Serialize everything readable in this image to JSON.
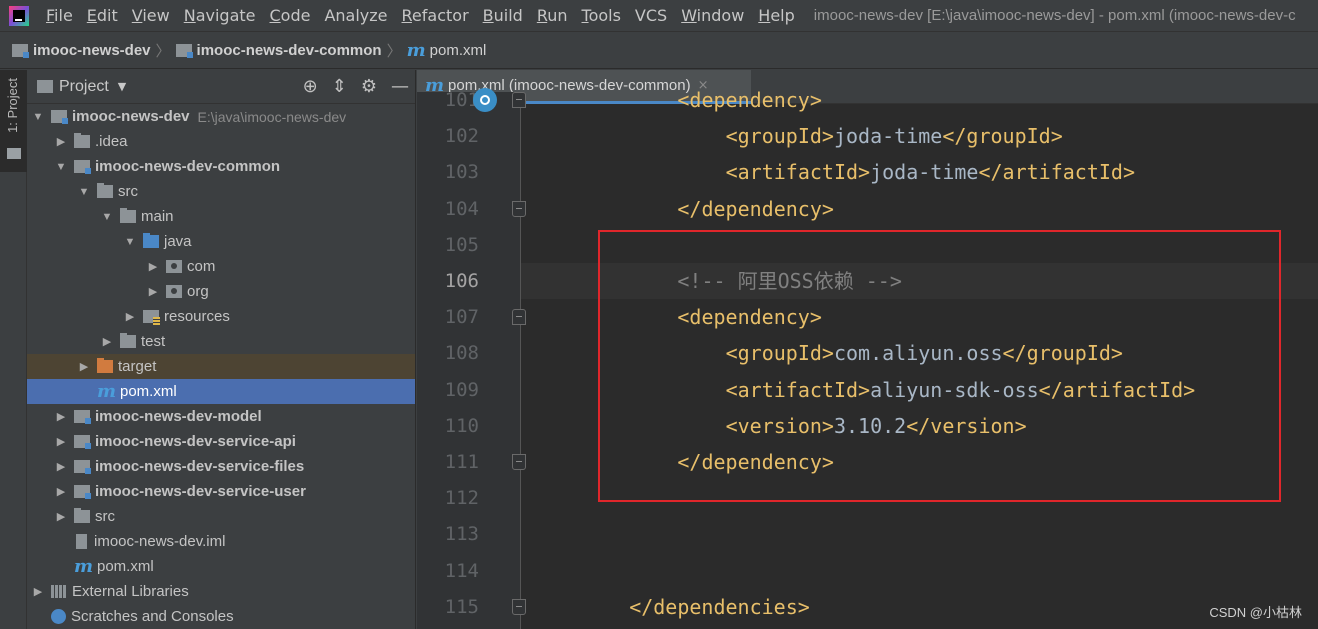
{
  "menu": {
    "items": [
      {
        "label": "File",
        "u": "F",
        "rest": "ile"
      },
      {
        "label": "Edit",
        "u": "E",
        "rest": "dit"
      },
      {
        "label": "View",
        "u": "V",
        "rest": "iew"
      },
      {
        "label": "Navigate",
        "u": "N",
        "rest": "avigate"
      },
      {
        "label": "Code",
        "u": "C",
        "rest": "ode"
      },
      {
        "label": "Analyze",
        "u": "",
        "rest": "Analyze"
      },
      {
        "label": "Refactor",
        "u": "R",
        "rest": "efactor"
      },
      {
        "label": "Build",
        "u": "B",
        "rest": "uild"
      },
      {
        "label": "Run",
        "u": "R",
        "rest": "un"
      },
      {
        "label": "Tools",
        "u": "T",
        "rest": "ools"
      },
      {
        "label": "VCS",
        "u": "",
        "rest": "VCS"
      },
      {
        "label": "Window",
        "u": "W",
        "rest": "indow"
      },
      {
        "label": "Help",
        "u": "H",
        "rest": "elp"
      }
    ],
    "window_title": "imooc-news-dev [E:\\java\\imooc-news-dev] - pom.xml (imooc-news-dev-c"
  },
  "breadcrumb": {
    "project": "imooc-news-dev",
    "module": "imooc-news-dev-common",
    "file": "pom.xml"
  },
  "tool_stripe": {
    "tab_label": "1: Project"
  },
  "project_panel": {
    "title": "Project",
    "caret": "▼",
    "tools": {
      "locate": "⊕",
      "collapse": "⇕",
      "settings": "⚙",
      "hide": "—"
    }
  },
  "tree": [
    {
      "label": "imooc-news-dev",
      "hint": "E:\\java\\imooc-news-dev",
      "depth": 0,
      "arrow": "▼",
      "icon": "module",
      "bold": true
    },
    {
      "label": ".idea",
      "depth": 1,
      "arrow": "▶",
      "icon": "folder"
    },
    {
      "label": "imooc-news-dev-common",
      "depth": 1,
      "arrow": "▼",
      "icon": "module",
      "bold": true
    },
    {
      "label": "src",
      "depth": 2,
      "arrow": "▼",
      "icon": "folder"
    },
    {
      "label": "main",
      "depth": 3,
      "arrow": "▼",
      "icon": "folder"
    },
    {
      "label": "java",
      "depth": 4,
      "arrow": "▼",
      "icon": "src"
    },
    {
      "label": "com",
      "depth": 5,
      "arrow": "▶",
      "icon": "pkg"
    },
    {
      "label": "org",
      "depth": 5,
      "arrow": "▶",
      "icon": "pkg"
    },
    {
      "label": "resources",
      "depth": 4,
      "arrow": "▶",
      "icon": "res"
    },
    {
      "label": "test",
      "depth": 3,
      "arrow": "▶",
      "icon": "folder"
    },
    {
      "label": "target",
      "depth": 2,
      "arrow": "▶",
      "icon": "excluded",
      "state": "target"
    },
    {
      "label": "pom.xml",
      "depth": 2,
      "arrow": "",
      "icon": "mfile",
      "state": "selected"
    },
    {
      "label": "imooc-news-dev-model",
      "depth": 1,
      "arrow": "▶",
      "icon": "module",
      "bold": true
    },
    {
      "label": "imooc-news-dev-service-api",
      "depth": 1,
      "arrow": "▶",
      "icon": "module",
      "bold": true
    },
    {
      "label": "imooc-news-dev-service-files",
      "depth": 1,
      "arrow": "▶",
      "icon": "module",
      "bold": true
    },
    {
      "label": "imooc-news-dev-service-user",
      "depth": 1,
      "arrow": "▶",
      "icon": "module",
      "bold": true
    },
    {
      "label": "src",
      "depth": 1,
      "arrow": "▶",
      "icon": "folder"
    },
    {
      "label": "imooc-news-dev.iml",
      "depth": 1,
      "arrow": "",
      "icon": "iml"
    },
    {
      "label": "pom.xml",
      "depth": 1,
      "arrow": "",
      "icon": "mfile"
    },
    {
      "label": "External Libraries",
      "depth": 0,
      "arrow": "▶",
      "icon": "lib"
    },
    {
      "label": "Scratches and Consoles",
      "depth": 0,
      "arrow": "",
      "icon": "scratch"
    }
  ],
  "editor": {
    "tab_label": "pom.xml (imooc-news-dev-common)",
    "tab_close": "×",
    "lines": [
      {
        "no": "101",
        "indent": 8,
        "parts": [
          [
            "tag",
            "<dependency>"
          ]
        ],
        "fold": "up",
        "bp": true
      },
      {
        "no": "102",
        "indent": 12,
        "parts": [
          [
            "tag",
            "<groupId>"
          ],
          [
            "txt",
            "joda-time"
          ],
          [
            "tag",
            "</groupId>"
          ]
        ]
      },
      {
        "no": "103",
        "indent": 12,
        "parts": [
          [
            "tag",
            "<artifactId>"
          ],
          [
            "txt",
            "joda-time"
          ],
          [
            "tag",
            "</artifactId>"
          ]
        ]
      },
      {
        "no": "104",
        "indent": 8,
        "parts": [
          [
            "tag",
            "</dependency>"
          ]
        ],
        "fold": "down"
      },
      {
        "no": "105",
        "indent": 0,
        "parts": []
      },
      {
        "no": "106",
        "indent": 8,
        "parts": [
          [
            "cmt",
            "<!-- 阿里OSS依赖 -->"
          ]
        ],
        "current": true
      },
      {
        "no": "107",
        "indent": 8,
        "parts": [
          [
            "tag",
            "<dependency>"
          ]
        ],
        "fold": "up"
      },
      {
        "no": "108",
        "indent": 12,
        "parts": [
          [
            "tag",
            "<groupId>"
          ],
          [
            "txt",
            "com.aliyun.oss"
          ],
          [
            "tag",
            "</groupId>"
          ]
        ]
      },
      {
        "no": "109",
        "indent": 12,
        "parts": [
          [
            "tag",
            "<artifactId>"
          ],
          [
            "txt",
            "aliyun-sdk-oss"
          ],
          [
            "tag",
            "</artifactId>"
          ]
        ]
      },
      {
        "no": "110",
        "indent": 12,
        "parts": [
          [
            "tag",
            "<version>"
          ],
          [
            "txt",
            "3.10.2"
          ],
          [
            "tag",
            "</version>"
          ]
        ]
      },
      {
        "no": "111",
        "indent": 8,
        "parts": [
          [
            "tag",
            "</dependency>"
          ]
        ],
        "fold": "down"
      },
      {
        "no": "112",
        "indent": 0,
        "parts": []
      },
      {
        "no": "113",
        "indent": 0,
        "parts": []
      },
      {
        "no": "114",
        "indent": 0,
        "parts": []
      },
      {
        "no": "115",
        "indent": 4,
        "parts": [
          [
            "tag",
            "</dependencies>"
          ]
        ],
        "fold": "down"
      }
    ]
  },
  "watermark": "CSDN @小枯林",
  "colors": {
    "tag": "#e8bf6a",
    "text": "#a9b7c6",
    "comment": "#808080",
    "selection": "#4b6eaf",
    "highlight_box": "#e0262b"
  }
}
